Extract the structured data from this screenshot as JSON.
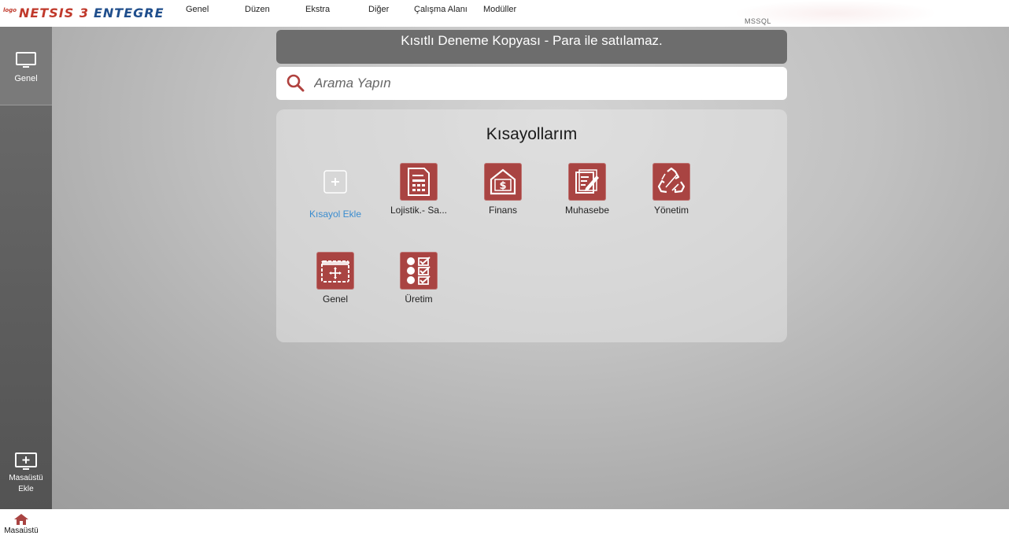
{
  "app": {
    "logo_prefix": "logo",
    "logo_main": "NETSIS 3",
    "logo_suffix": "ENTEGRE",
    "db_label": "MSSQL"
  },
  "menu": {
    "items": [
      {
        "label": "Genel"
      },
      {
        "label": "Düzen"
      },
      {
        "label": "Ekstra"
      },
      {
        "label": "Diğer"
      },
      {
        "label": "Çalışma Alanı"
      },
      {
        "label": "Modüller"
      }
    ]
  },
  "sidebar": {
    "genel_label": "Genel",
    "add_desktop_line1": "Masaüstü",
    "add_desktop_line2": "Ekle"
  },
  "banner": {
    "text": "Kısıtlı Deneme Kopyası - Para ile satılamaz."
  },
  "search": {
    "placeholder": "Arama Yapın",
    "value": ""
  },
  "shortcuts": {
    "title": "Kısayollarım",
    "add_label": "Kısayol Ekle",
    "items": [
      {
        "label": "Lojistik.- Sa...",
        "icon": "document-calculator-icon"
      },
      {
        "label": "Finans",
        "icon": "finance-dollar-icon"
      },
      {
        "label": "Muhasebe",
        "icon": "accounting-edit-icon"
      },
      {
        "label": "Yönetim",
        "icon": "recycle-icon"
      },
      {
        "label": "Genel",
        "icon": "general-move-icon"
      },
      {
        "label": "Üretim",
        "icon": "production-checklist-icon"
      }
    ]
  },
  "taskbar": {
    "home_label": "Masaüstü"
  },
  "colors": {
    "tile_bg": "#a94442",
    "add_label": "#3a8ccf",
    "rail_bg": "#5e5e5e",
    "banner_bg": "#6d6d6d"
  }
}
